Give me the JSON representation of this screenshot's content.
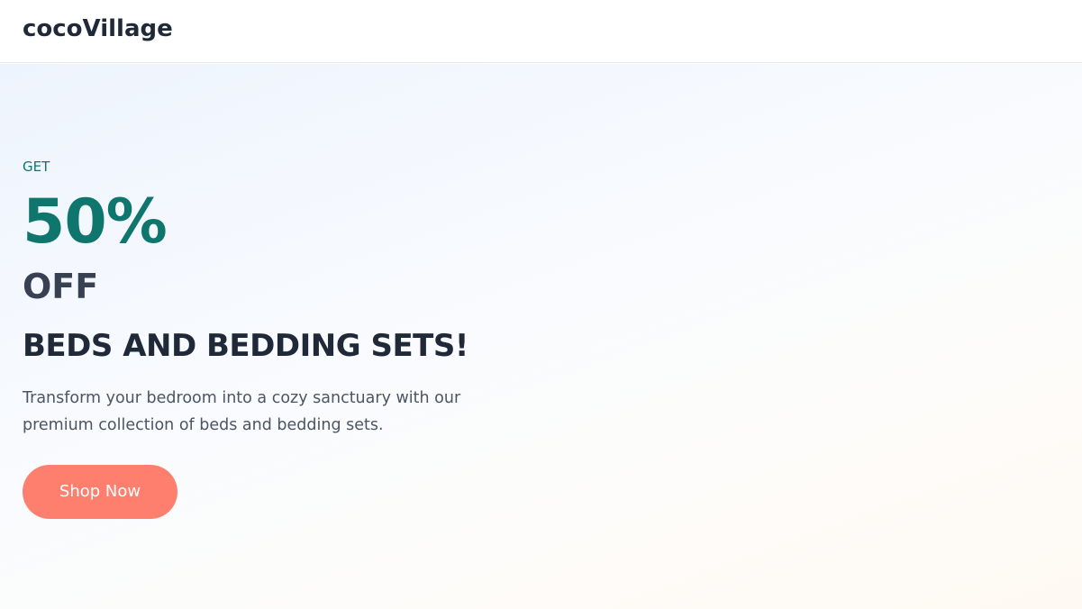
{
  "header": {
    "logo": "cocoVillage"
  },
  "hero": {
    "eyebrow": "GET",
    "discount": "50%",
    "off": "OFF",
    "headline": "BEDS AND BEDDING SETS!",
    "description": "Transform your bedroom into a cozy sanctuary with our premium collection of beds and bedding sets.",
    "cta_label": "Shop Now"
  },
  "colors": {
    "accent_teal": "#0f766e",
    "cta_coral": "#ff7f6e",
    "heading_dark": "#1f2937",
    "body_gray": "#4b5563"
  }
}
